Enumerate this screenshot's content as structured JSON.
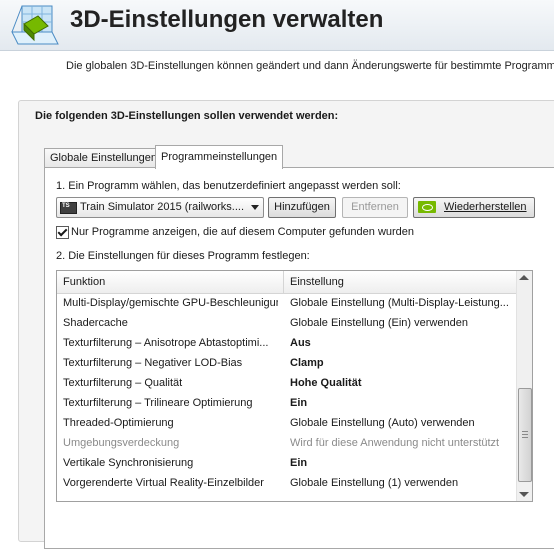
{
  "header": {
    "title": "3D-Einstellungen verwalten",
    "description": "Die globalen 3D-Einstellungen können geändert und dann Änderungswerte für bestimmte Programme ers"
  },
  "panel": {
    "heading": "Die folgenden 3D-Einstellungen sollen verwendet werden:"
  },
  "tabs": [
    {
      "label": "Globale Einstellungen",
      "selected": false
    },
    {
      "label": "Programmeinstellungen",
      "selected": true
    }
  ],
  "program_settings": {
    "step1_label": "1. Ein Programm wählen, das benutzerdefiniert angepasst werden soll:",
    "program_select": {
      "value": "Train Simulator 2015 (railworks....",
      "icon_text": "TS"
    },
    "buttons": {
      "add": "Hinzufügen",
      "remove": "Entfernen",
      "restore": "Wiederherstellen"
    },
    "only_installed": {
      "label": "Nur Programme anzeigen, die auf diesem Computer gefunden wurden",
      "checked": true
    },
    "step2_label": "2. Die Einstellungen für dieses Programm festlegen:"
  },
  "settings_table": {
    "columns": [
      "Funktion",
      "Einstellung"
    ],
    "rows": [
      {
        "function": "Multi-Display/gemischte GPU-Beschleunigung",
        "setting": "Globale Einstellung (Multi-Display-Leistung...",
        "bold": false,
        "muted": false
      },
      {
        "function": "Shadercache",
        "setting": "Globale Einstellung (Ein) verwenden",
        "bold": false,
        "muted": false
      },
      {
        "function": "Texturfilterung – Anisotrope Abtastoptimi...",
        "setting": "Aus",
        "bold": true,
        "muted": false
      },
      {
        "function": "Texturfilterung – Negativer LOD-Bias",
        "setting": "Clamp",
        "bold": true,
        "muted": false
      },
      {
        "function": "Texturfilterung – Qualität",
        "setting": "Hohe Qualität",
        "bold": true,
        "muted": false
      },
      {
        "function": "Texturfilterung – Trilineare Optimierung",
        "setting": "Ein",
        "bold": true,
        "muted": false
      },
      {
        "function": "Threaded-Optimierung",
        "setting": "Globale Einstellung (Auto) verwenden",
        "bold": false,
        "muted": false
      },
      {
        "function": "Umgebungsverdeckung",
        "setting": "Wird für diese Anwendung nicht unterstützt",
        "bold": false,
        "muted": true
      },
      {
        "function": "Vertikale Synchronisierung",
        "setting": "Ein",
        "bold": true,
        "muted": false
      },
      {
        "function": "Vorgerenderte Virtual Reality-Einzelbilder",
        "setting": "Globale Einstellung (1) verwenden",
        "bold": false,
        "muted": false
      }
    ]
  },
  "colors": {
    "nvidia_green": "#76b900",
    "header_bg": "#e3e9ef",
    "muted_text": "#8a8a8a"
  }
}
